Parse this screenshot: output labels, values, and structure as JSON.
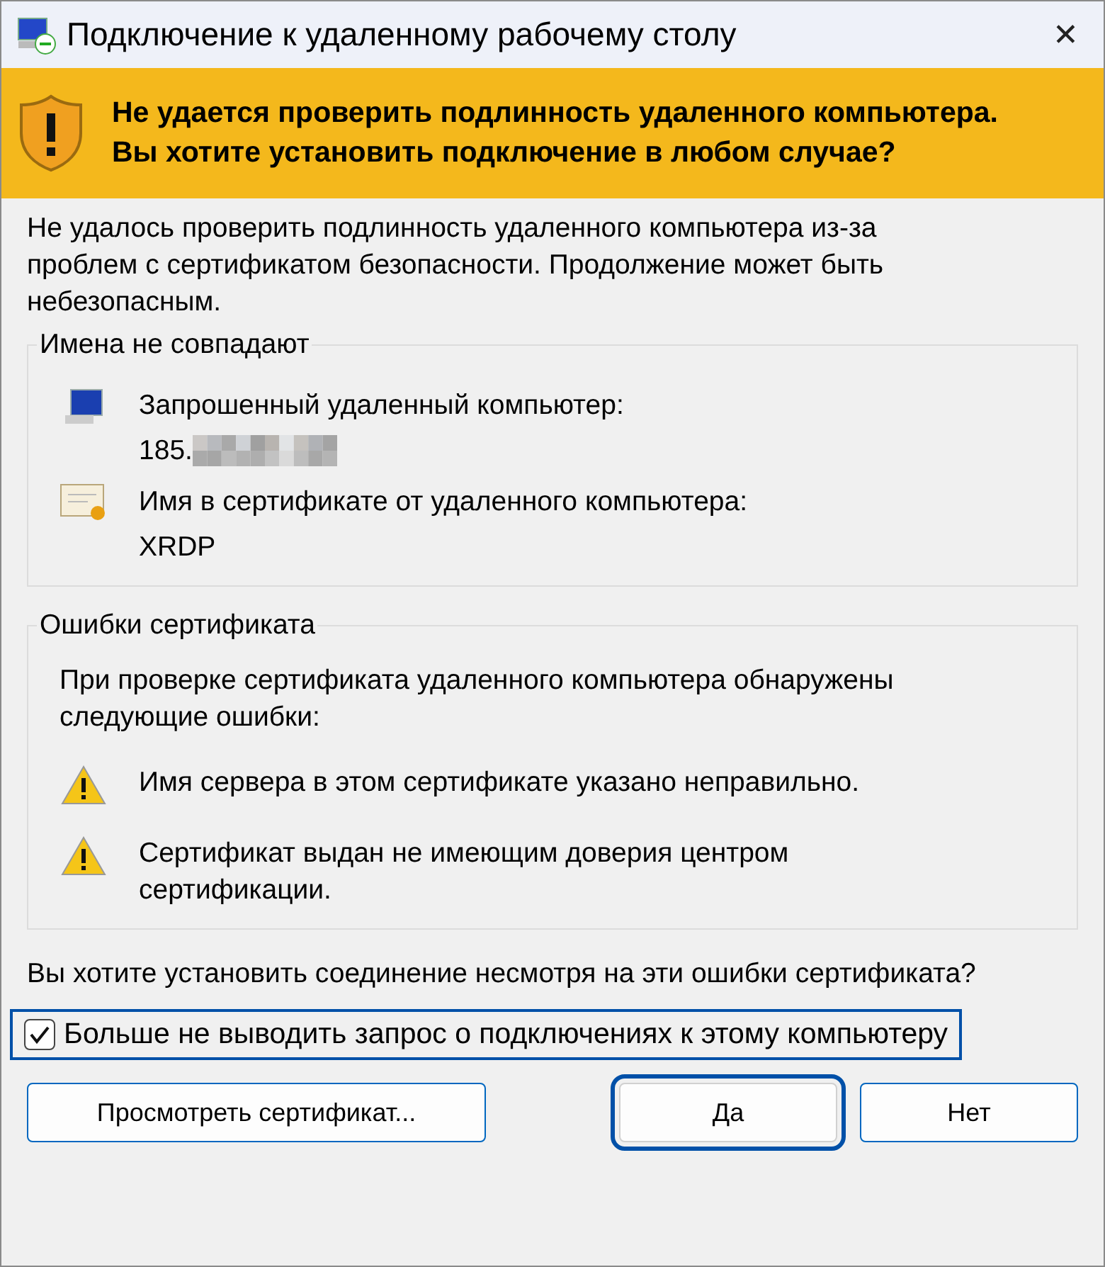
{
  "window": {
    "title": "Подключение к удаленному рабочему столу",
    "close": "✕"
  },
  "banner": {
    "lines": [
      "Не удается проверить подлинность удаленного компьютера.",
      "Вы хотите установить подключение в любом случае?"
    ]
  },
  "description": "Не удалось проверить подлинность удаленного компьютера из-за проблем с сертификатом безопасности. Продолжение может быть небезопасным.",
  "groups": [
    {
      "title": "Имена не совпадают",
      "items": [
        {
          "kind": "computer",
          "label": "Запрошенный удаленный компьютер:",
          "value": "185.",
          "redacted": true
        },
        {
          "kind": "certificate",
          "label": "Имя в сертификате от удаленного компьютера:",
          "value": "XRDP",
          "redacted": false
        }
      ]
    },
    {
      "title": "Ошибки сертификата",
      "intro": "При проверке сертификата удаленного компьютера обнаружены следующие ошибки:",
      "items": [
        {
          "kind": "warning",
          "label": "Имя сервера в этом сертификате указано неправильно."
        },
        {
          "kind": "warning",
          "label": "Сертификат выдан не имеющим доверия центром сертификации."
        }
      ]
    }
  ],
  "question": "Вы хотите установить соединение несмотря на эти ошибки сертификата?",
  "checkbox": {
    "label": "Больше не выводить запрос о подключениях к этому компьютеру",
    "checked": true,
    "focused": true
  },
  "view_button": {
    "label": "Просмотреть сертификат...",
    "focused": false
  },
  "buttons": [
    {
      "label": "Да",
      "focused": true
    },
    {
      "label": "Нет",
      "focused": false
    }
  ]
}
